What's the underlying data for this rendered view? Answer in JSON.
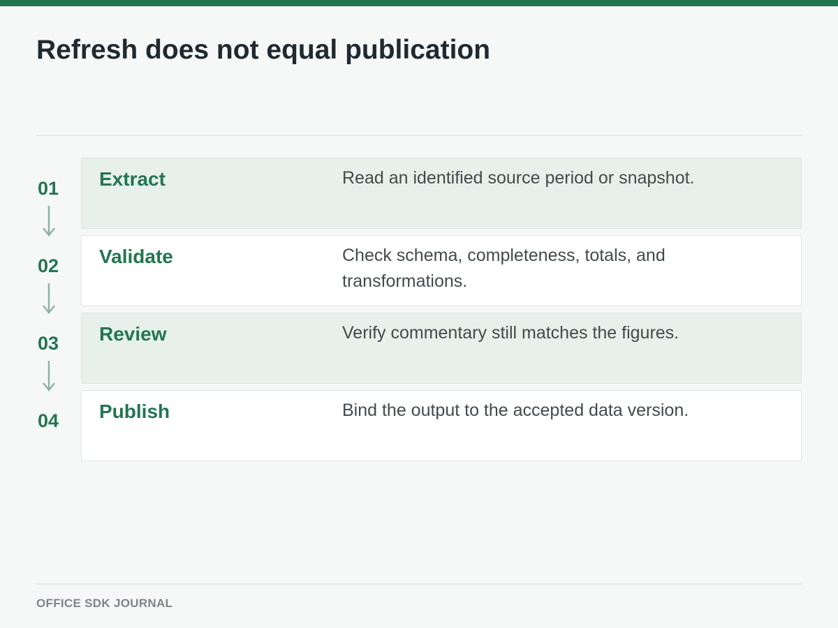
{
  "slide": {
    "title": "Refresh does not equal publication",
    "footer": "OFFICE SDK JOURNAL"
  },
  "colors": {
    "accent": "#237552",
    "card_shaded": "#e7f0eb",
    "card_plain": "#ffffff",
    "arrow": "#8db3a2",
    "background": "#f6f8f7"
  },
  "steps": [
    {
      "number": "01",
      "name": "Extract",
      "description": "Read an identified source period or snapshot."
    },
    {
      "number": "02",
      "name": "Validate",
      "description": "Check schema, completeness, totals, and transformations."
    },
    {
      "number": "03",
      "name": "Review",
      "description": "Verify commentary still matches the figures."
    },
    {
      "number": "04",
      "name": "Publish",
      "description": "Bind the output to the accepted data version."
    }
  ]
}
